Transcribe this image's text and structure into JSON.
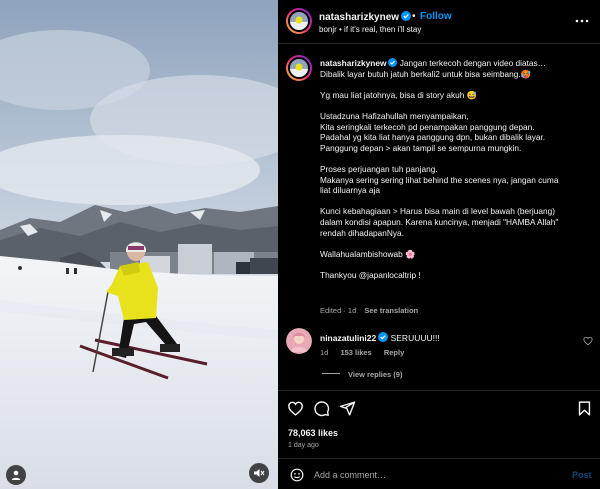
{
  "colors": {
    "accent": "#0095f6",
    "muted": "#a8a8a8",
    "verified": "#0095f6",
    "background": "#000000",
    "jacket": "#e8e21c"
  },
  "post": {
    "header": {
      "username": "natasharizkynew",
      "separator": "•",
      "follow_label": "Follow",
      "subtitle": "bonjr • if it's real, then i'll stay"
    },
    "caption": {
      "username": "natasharizkynew",
      "text": "Jangan terkecoh dengan video diatas…\nDibalik layar butuh jatuh berkali2 untuk bisa seimbang.🥵\n\nYg mau liat jatohnya, bisa di story akuh 😅\n\nUstadzuna Hafizahullah menyampaikan,\nKita seringkali terkecoh pd penampakan panggung depan.\nPadahal yg kita liat hanya panggung dpn, bukan dibalik layar.\nPanggung depan > akan tampil se sempurna mungkin.\n\nProses perjuangan tuh panjang.\nMakanya sering sering lihat behind the scenes nya, jangan cuma\nliat diluarnya aja\n\nKunci kebahagiaan > Harus bisa main di level bawah (berjuang)\ndalam kondisi apapun. Karena kuncinya, menjadi \"HAMBA Allah\"\nrendah dihadapanNya.\n\nWallahualambishowab 🌸\n\nThankyou @japanlocaltrip !",
      "edited": "Edited · 1d",
      "see_translation": "See translation"
    },
    "comments": [
      {
        "username": "ninazatulini22",
        "text": "SERUUUU!!!",
        "time": "1d",
        "likes": "153 likes",
        "reply_label": "Reply",
        "view_replies": "View replies (9)"
      }
    ],
    "likes": "78,063 likes",
    "time_ago": "1 day ago",
    "comment_input": {
      "placeholder": "Add a comment…",
      "post_label": "Post"
    },
    "icons": [
      "heart-icon",
      "comment-icon",
      "share-icon",
      "bookmark-icon",
      "emoji-icon",
      "more-icon",
      "user-tag-icon",
      "mute-icon"
    ]
  }
}
